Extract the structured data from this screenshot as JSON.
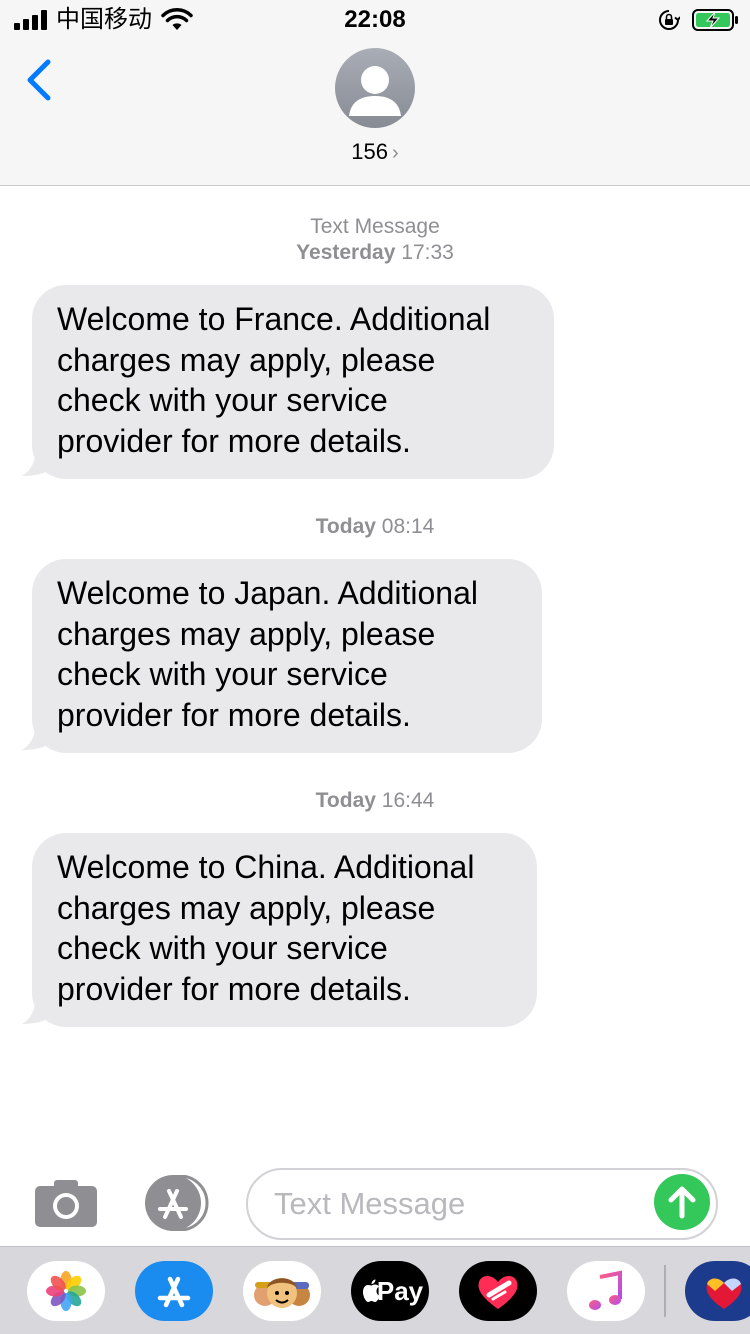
{
  "status_bar": {
    "carrier": "中国移动",
    "time": "22:08"
  },
  "header": {
    "contact_name": "156",
    "chevron": "›"
  },
  "conversation": {
    "service_label": "Text Message",
    "messages": [
      {
        "day": "Yesterday",
        "time": "17:33",
        "text_lines": [
          "Welcome to France. Additional",
          "charges may apply, please",
          "check with your service",
          "provider for more details."
        ]
      },
      {
        "day": "Today",
        "time": "08:14",
        "text_lines": [
          "Welcome to Japan. Additional",
          "charges may apply, please",
          "check with your service",
          "provider for more details."
        ]
      },
      {
        "day": "Today",
        "time": "16:44",
        "text_lines": [
          "Welcome to China. Additional",
          "charges may apply, please",
          "check with your service",
          "provider for more details."
        ]
      }
    ]
  },
  "composer": {
    "placeholder": "Text Message",
    "value": ""
  },
  "app_drawer": {
    "apple_pay_label": "Pay",
    "apps": [
      "photos-icon",
      "app-store-icon",
      "memoji-icon",
      "apple-pay-icon",
      "heart-app-icon",
      "music-icon",
      "southwest-icon"
    ]
  },
  "colors": {
    "bubble": "#e9e9eb",
    "send": "#34c759",
    "accent": "#007aff",
    "timestamp": "#8e8e93"
  }
}
